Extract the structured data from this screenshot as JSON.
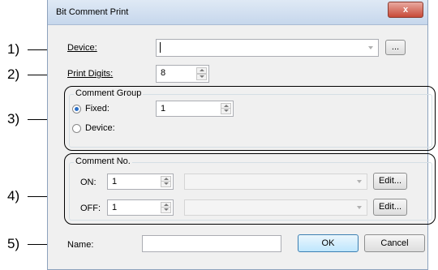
{
  "dialog": {
    "title": "Bit Comment Print",
    "close_glyph": "x"
  },
  "callouts": [
    "1)",
    "2)",
    "3)",
    "4)",
    "5)"
  ],
  "device": {
    "label": "Device:",
    "value": "",
    "browse_label": "..."
  },
  "print_digits": {
    "label": "Print Digits:",
    "value": "8"
  },
  "comment_group": {
    "title": "Comment Group",
    "fixed": {
      "label": "Fixed:",
      "value": "1",
      "checked": true
    },
    "device": {
      "label": "Device:",
      "checked": false
    }
  },
  "comment_no": {
    "title": "Comment No.",
    "on": {
      "label": "ON:",
      "value": "1",
      "edit_label": "Edit..."
    },
    "off": {
      "label": "OFF:",
      "value": "1",
      "edit_label": "Edit..."
    }
  },
  "footer": {
    "name_label": "Name:",
    "name_value": "",
    "ok_label": "OK",
    "cancel_label": "Cancel"
  },
  "colors": {
    "accent": "#2b6fc6",
    "window_bg": "#f0f0f0",
    "close_red": "#c74a38"
  }
}
